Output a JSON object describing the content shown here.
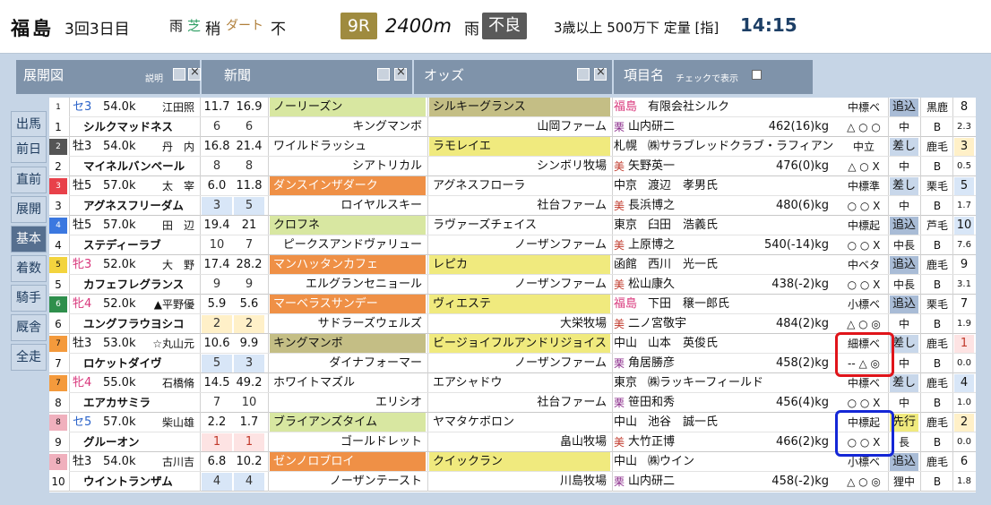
{
  "header": {
    "venue": "福島",
    "meeting": "3回3日目",
    "weather_label": "雨",
    "turf_label": "芝",
    "turf_condition": "稍",
    "dirt_label": "ダート",
    "dirt_condition": "不",
    "race_no": "9R",
    "distance": "2400m",
    "weather": "雨",
    "condition": "不良",
    "race_class": "3歳以上 500万下 定量 [指]",
    "post_time": "14:15"
  },
  "toolbar": {
    "tenkai": "展開図",
    "tenkai_note": "説明",
    "shinbun": "新聞",
    "odds": "オッズ",
    "koumoku": "項目名",
    "check_label": "チェックで表示"
  },
  "side_tabs": [
    "出馬",
    "前日",
    "直前",
    "展開",
    "基本",
    "着数",
    "騎手",
    "厩舎",
    "全走"
  ],
  "side_active": "基本",
  "colors": {
    "frame": [
      "#ffffff",
      "#555555",
      "#e8414a",
      "#3b78e0",
      "#f3d43e",
      "#2f8f4c",
      "#f49a3c",
      "#f0b0bd"
    ],
    "sire_orange": "#ef9046",
    "sire_olive": "#c4be85",
    "sire_lightgreen": "#d8e7a1",
    "sire_yellow": "#f0ea7e",
    "sire_white": "#ffffff",
    "highlight_red": "#e0141a",
    "highlight_blue": "#1427d6"
  },
  "horses": [
    {
      "frame": "1",
      "num": "1",
      "sexage": "セ3",
      "weight": "54.0k",
      "jockey": "江田照",
      "odds": "11.7",
      "odds2": "16.9",
      "pop": "6",
      "pop2": "6",
      "sire": "ノーリーズン",
      "dam_sire": "キングマンボ",
      "dam": "シルキーグランス",
      "breeder": "山岡ファーム",
      "loc": "福島",
      "owner": "有限会社シルク",
      "affil": "栗",
      "trainer": "山内研二",
      "bw": "462(16)kg",
      "rank": "中標ベ",
      "marks": "△ ○ ○",
      "style": "追込",
      "coat": "黒鹿",
      "g1": "8",
      "g2": "2.3",
      "name": "シルクマッドネス",
      "mid": "中",
      "grade": "B"
    },
    {
      "frame": "2",
      "num": "2",
      "sexage": "牡3",
      "weight": "54.0k",
      "jockey": "丹　内",
      "odds": "16.8",
      "odds2": "21.4",
      "pop": "8",
      "pop2": "8",
      "sire": "ワイルドラッシュ",
      "dam_sire": "シアトリカル",
      "dam": "ラモレイエ",
      "breeder": "シンボリ牧場",
      "loc": "札幌",
      "owner": "㈱サラブレッドクラブ・ラフィアン",
      "affil": "美",
      "trainer": "矢野英一",
      "bw": "476(0)kg",
      "rank": "中立",
      "marks": "△ ○ X",
      "style": "差し",
      "coat": "鹿毛",
      "g1": "3",
      "g2": "0.5",
      "name": "マイネルバンベール",
      "mid": "中",
      "grade": "B"
    },
    {
      "frame": "3",
      "num": "3",
      "sexage": "牡5",
      "weight": "57.0k",
      "jockey": "太　宰",
      "odds": "6.0",
      "odds2": "11.8",
      "pop": "3",
      "pop2": "5",
      "sire": "ダンスインザダーク",
      "dam_sire": "ロイヤルスキー",
      "dam": "アグネスフローラ",
      "breeder": "社台ファーム",
      "loc": "中京",
      "owner": "渡辺　孝男氏",
      "affil": "美",
      "trainer": "長浜博之",
      "bw": "480(6)kg",
      "rank": "中標準",
      "marks": "○ ○ X",
      "style": "差し",
      "coat": "栗毛",
      "g1": "5",
      "g2": "1.7",
      "name": "アグネスフリーダム",
      "mid": "中",
      "grade": "B"
    },
    {
      "frame": "4",
      "num": "4",
      "sexage": "牡5",
      "weight": "57.0k",
      "jockey": "田　辺",
      "odds": "19.4",
      "odds2": "21",
      "pop": "10",
      "pop2": "7",
      "sire": "クロフネ",
      "dam_sire": "ピークスアンドヴァリュー",
      "dam": "ラヴァーズチェイス",
      "breeder": "ノーザンファーム",
      "loc": "東京",
      "owner": "臼田　浩義氏",
      "affil": "美",
      "trainer": "上原博之",
      "bw": "540(-14)kg",
      "rank": "中標起",
      "marks": "○ ○ X",
      "style": "追込",
      "coat": "芦毛",
      "g1": "10",
      "g2": "7.6",
      "name": "ステディーラブ",
      "mid": "中長",
      "grade": "B"
    },
    {
      "frame": "5",
      "num": "5",
      "sexage": "牝3",
      "weight": "52.0k",
      "jockey": "大　野",
      "odds": "17.4",
      "odds2": "28.2",
      "pop": "9",
      "pop2": "9",
      "sire": "マンハッタンカフェ",
      "dam_sire": "エルグランセニョール",
      "dam": "レピカ",
      "breeder": "ノーザンファーム",
      "loc": "函館",
      "owner": "西川　光一氏",
      "affil": "美",
      "trainer": "松山康久",
      "bw": "438(-2)kg",
      "rank": "中ベタ",
      "marks": "○ ○ X",
      "style": "追込",
      "coat": "鹿毛",
      "g1": "9",
      "g2": "3.1",
      "name": "カフェフレグランス",
      "mid": "中長",
      "grade": "B"
    },
    {
      "frame": "6",
      "num": "6",
      "sexage": "牝4",
      "weight": "52.0k",
      "jockey": "▲平野優",
      "odds": "5.9",
      "odds2": "5.6",
      "pop": "2",
      "pop2": "2",
      "sire": "マーベラスサンデー",
      "dam_sire": "サドラーズウェルズ",
      "dam": "ヴィエステ",
      "breeder": "大栄牧場",
      "loc": "福島",
      "owner": "下田　穣一郎氏",
      "affil": "美",
      "trainer": "二ノ宮敬宇",
      "bw": "484(2)kg",
      "rank": "小標ベ",
      "marks": "△ ○ ◎",
      "style": "追込",
      "coat": "栗毛",
      "g1": "7",
      "g2": "1.9",
      "name": "ユングフラウヨシコ",
      "mid": "中",
      "grade": "B"
    },
    {
      "frame": "7",
      "num": "7",
      "sexage": "牡3",
      "weight": "53.0k",
      "jockey": "☆丸山元",
      "odds": "10.6",
      "odds2": "9.9",
      "pop": "5",
      "pop2": "3",
      "sire": "キングマンボ",
      "dam_sire": "ダイナフォーマー",
      "dam": "ビージョイフルアンドリジョイス",
      "breeder": "ノーザンファーム",
      "loc": "中山",
      "owner": "山本　英俊氏",
      "affil": "栗",
      "trainer": "角居勝彦",
      "bw": "458(2)kg",
      "rank": "細標ベ",
      "marks": "-- △ ◎",
      "style": "差し",
      "coat": "鹿毛",
      "g1": "1",
      "g2": "0.0",
      "name": "ロケットダイヴ",
      "mid": "中",
      "grade": "B"
    },
    {
      "frame": "7",
      "num": "8",
      "sexage": "牝4",
      "weight": "55.0k",
      "jockey": "石橋脩",
      "odds": "14.5",
      "odds2": "49.2",
      "pop": "7",
      "pop2": "10",
      "sire": "ホワイトマズル",
      "dam_sire": "エリシオ",
      "dam": "エアシャドウ",
      "breeder": "社台ファーム",
      "loc": "東京",
      "owner": "㈱ラッキーフィールド",
      "affil": "栗",
      "trainer": "笹田和秀",
      "bw": "456(4)kg",
      "rank": "中標ベ",
      "marks": "○ ○ X",
      "style": "差し",
      "coat": "鹿毛",
      "g1": "4",
      "g2": "1.0",
      "name": "エアカサミラ",
      "mid": "中",
      "grade": "B"
    },
    {
      "frame": "8",
      "num": "9",
      "sexage": "セ5",
      "weight": "57.0k",
      "jockey": "柴山雄",
      "odds": "2.2",
      "odds2": "1.7",
      "pop": "1",
      "pop2": "1",
      "sire": "ブライアンズタイム",
      "dam_sire": "ゴールドレット",
      "dam": "ヤマタケボロン",
      "breeder": "畠山牧場",
      "loc": "中山",
      "owner": "池谷　誠一氏",
      "affil": "美",
      "trainer": "大竹正博",
      "bw": "466(2)kg",
      "rank": "中標起",
      "marks": "○ ○ X",
      "style": "先行",
      "coat": "鹿毛",
      "g1": "2",
      "g2": "0.0",
      "name": "グルーオン",
      "mid": "長",
      "grade": "B"
    },
    {
      "frame": "8",
      "num": "10",
      "sexage": "牡3",
      "weight": "54.0k",
      "jockey": "古川吉",
      "odds": "6.8",
      "odds2": "10.2",
      "pop": "4",
      "pop2": "4",
      "sire": "ゼンノロブロイ",
      "dam_sire": "ノーザンテースト",
      "dam": "クイックラン",
      "breeder": "川島牧場",
      "loc": "中山",
      "owner": "㈱ウイン",
      "affil": "栗",
      "trainer": "山内研二",
      "bw": "458(-2)kg",
      "rank": "小標ベ",
      "marks": "△ ○ ◎",
      "style": "追込",
      "coat": "鹿毛",
      "g1": "6",
      "g2": "1.8",
      "name": "ウイントランザム",
      "mid": "狸中",
      "grade": "B"
    }
  ]
}
